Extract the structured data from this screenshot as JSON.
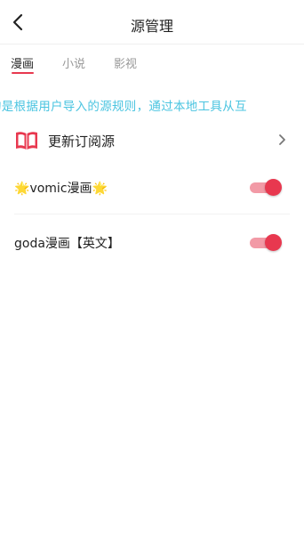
{
  "header": {
    "title": "源管理",
    "back_icon": "chevron-left-icon"
  },
  "tabs": [
    {
      "label": "漫画",
      "active": true
    },
    {
      "label": "小说",
      "active": false
    },
    {
      "label": "影视",
      "active": false
    }
  ],
  "notice": {
    "text": "均是根据用户导入的源规则，通过本地工具从互"
  },
  "update_row": {
    "label": "更新订阅源",
    "icon": "book-icon",
    "chevron": "chevron-right-icon"
  },
  "sources": [
    {
      "star_left": "🌟",
      "name": "vomic漫画",
      "star_right": "🌟",
      "enabled": true
    },
    {
      "star_left": "",
      "name": "goda漫画【英文】",
      "star_right": "",
      "enabled": true
    }
  ],
  "colors": {
    "accent": "#e8384f",
    "toggle_track": "#f29aa6",
    "notice": "#4ac4e0",
    "book_icon": "#e8384f"
  }
}
